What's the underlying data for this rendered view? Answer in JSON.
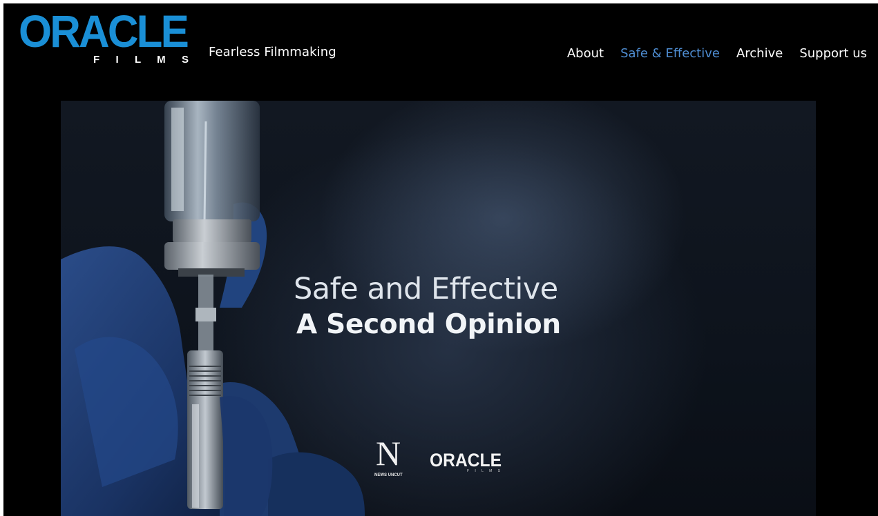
{
  "brand": {
    "logo_text": "ORACLE",
    "logo_subtext": "F I L M S",
    "tagline": "Fearless Filmmaking",
    "accent_color": "#1a8fd6"
  },
  "nav": {
    "items": [
      {
        "label": "About",
        "active": false
      },
      {
        "label": "Safe & Effective",
        "active": true
      },
      {
        "label": "Archive",
        "active": false
      },
      {
        "label": "Support us",
        "active": false
      }
    ],
    "active_color": "#4f8ed3"
  },
  "hero": {
    "title_line1": "Safe and Effective",
    "title_line2": "A Second Opinion",
    "partner_logos": [
      {
        "name": "news-uncut-logo",
        "text": "NEWS UNCUT",
        "mark": "N"
      },
      {
        "name": "oracle-films-small-logo",
        "text": "ORACLE",
        "subtext": "FILMS"
      }
    ]
  }
}
